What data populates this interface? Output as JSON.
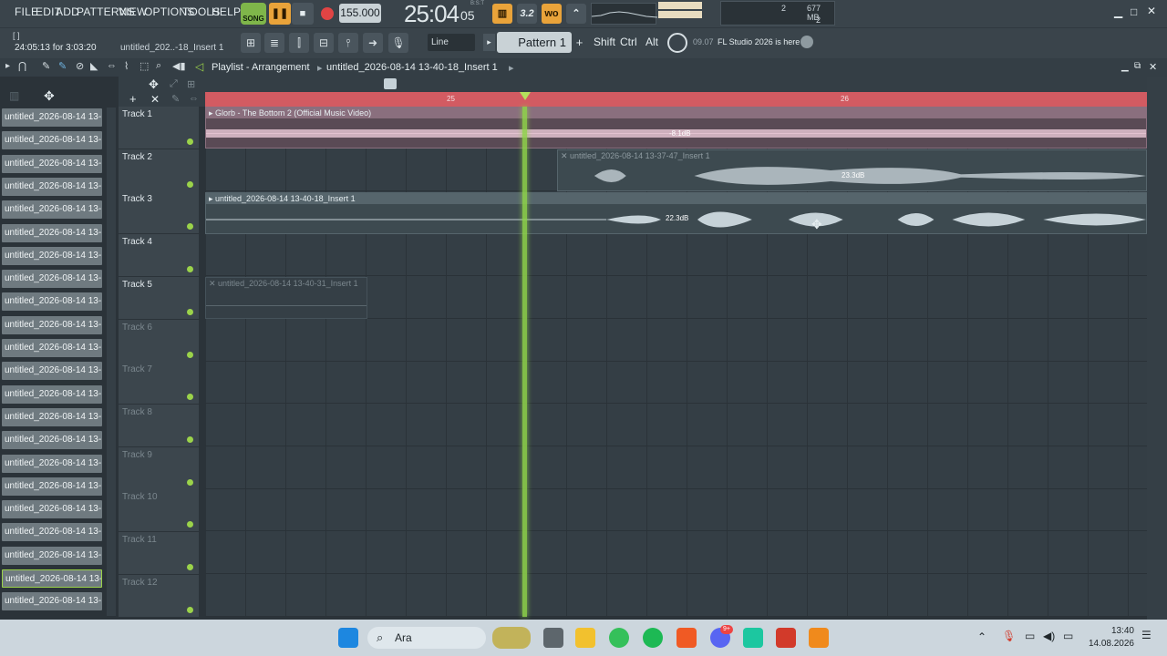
{
  "menu": [
    "FILE",
    "EDIT",
    "ADD",
    "PATTERNS",
    "VIEW",
    "OPTIONS",
    "TOOLS",
    "HELP"
  ],
  "transport": {
    "song_label": "SONG",
    "bpm": "155.000",
    "time": "25:04",
    "time_ticks": "05",
    "time_mode": "B:S:T"
  },
  "cpu": {
    "cpu_value": "2",
    "memory": "677 MB",
    "poly": "2"
  },
  "hint": {
    "line1": "[ ]",
    "line2": "24:05:13 for 3:03:20",
    "file": "untitled_202..-18_Insert 1"
  },
  "toolbar": {
    "snap": "Line",
    "pattern": "Pattern 1",
    "shift": "Shift",
    "ctrl": "Ctrl",
    "alt": "Alt",
    "news_time": "09.07",
    "news_text": "FL Studio 2026 is here"
  },
  "playlist": {
    "title": "Playlist - Arrangement",
    "breadcrumb": "untitled_2026-08-14 13-40-18_Insert 1",
    "bar_25": "25",
    "bar_26": "26"
  },
  "browser_items": [
    "untitled_2026-08-14 13-...",
    "untitled_2026-08-14 13-...",
    "untitled_2026-08-14 13-...",
    "untitled_2026-08-14 13-...",
    "untitled_2026-08-14 13-...",
    "untitled_2026-08-14 13-...",
    "untitled_2026-08-14 13-...",
    "untitled_2026-08-14 13-...",
    "untitled_2026-08-14 13-...",
    "untitled_2026-08-14 13-...",
    "untitled_2026-08-14 13-...",
    "untitled_2026-08-14 13-...",
    "untitled_2026-08-14 13-...",
    "untitled_2026-08-14 13-...",
    "untitled_2026-08-14 13-...",
    "untitled_2026-08-14 13-...",
    "untitled_2026-08-14 13-...",
    "untitled_2026-08-14 13-...",
    "untitled_2026-08-14 13-...",
    "untitled_2026-08-14 13-...",
    "untitled_2026-08-14 13-...",
    "untitled_2026-08-14 13-..."
  ],
  "tracks": [
    "Track 1",
    "Track 2",
    "Track 3",
    "Track 4",
    "Track 5",
    "Track 6",
    "Track 7",
    "Track 8",
    "Track 9",
    "Track 10",
    "Track 11",
    "Track 12"
  ],
  "clips": {
    "clip1_title": "Glorb - The Bottom 2 (Official Music Video)",
    "clip1_gain": "-8.1dB",
    "clip2_title": "untitled_2026-08-14 13-37-47_Insert 1",
    "clip2_gain": "23.3dB",
    "clip3_title": "untitled_2026-08-14 13-40-18_Insert 1",
    "clip3_gain": "22.3dB",
    "clip4_title": "untitled_2026-08-14 13-40-31_Insert 1"
  },
  "taskbar": {
    "search": "Ara",
    "time": "13:40",
    "date": "14.08.2026",
    "discord_badge": "9+"
  },
  "colors": {
    "accent_green": "#9bd34a",
    "timeline_red": "#d25b62",
    "orange": "#e9a33a"
  }
}
